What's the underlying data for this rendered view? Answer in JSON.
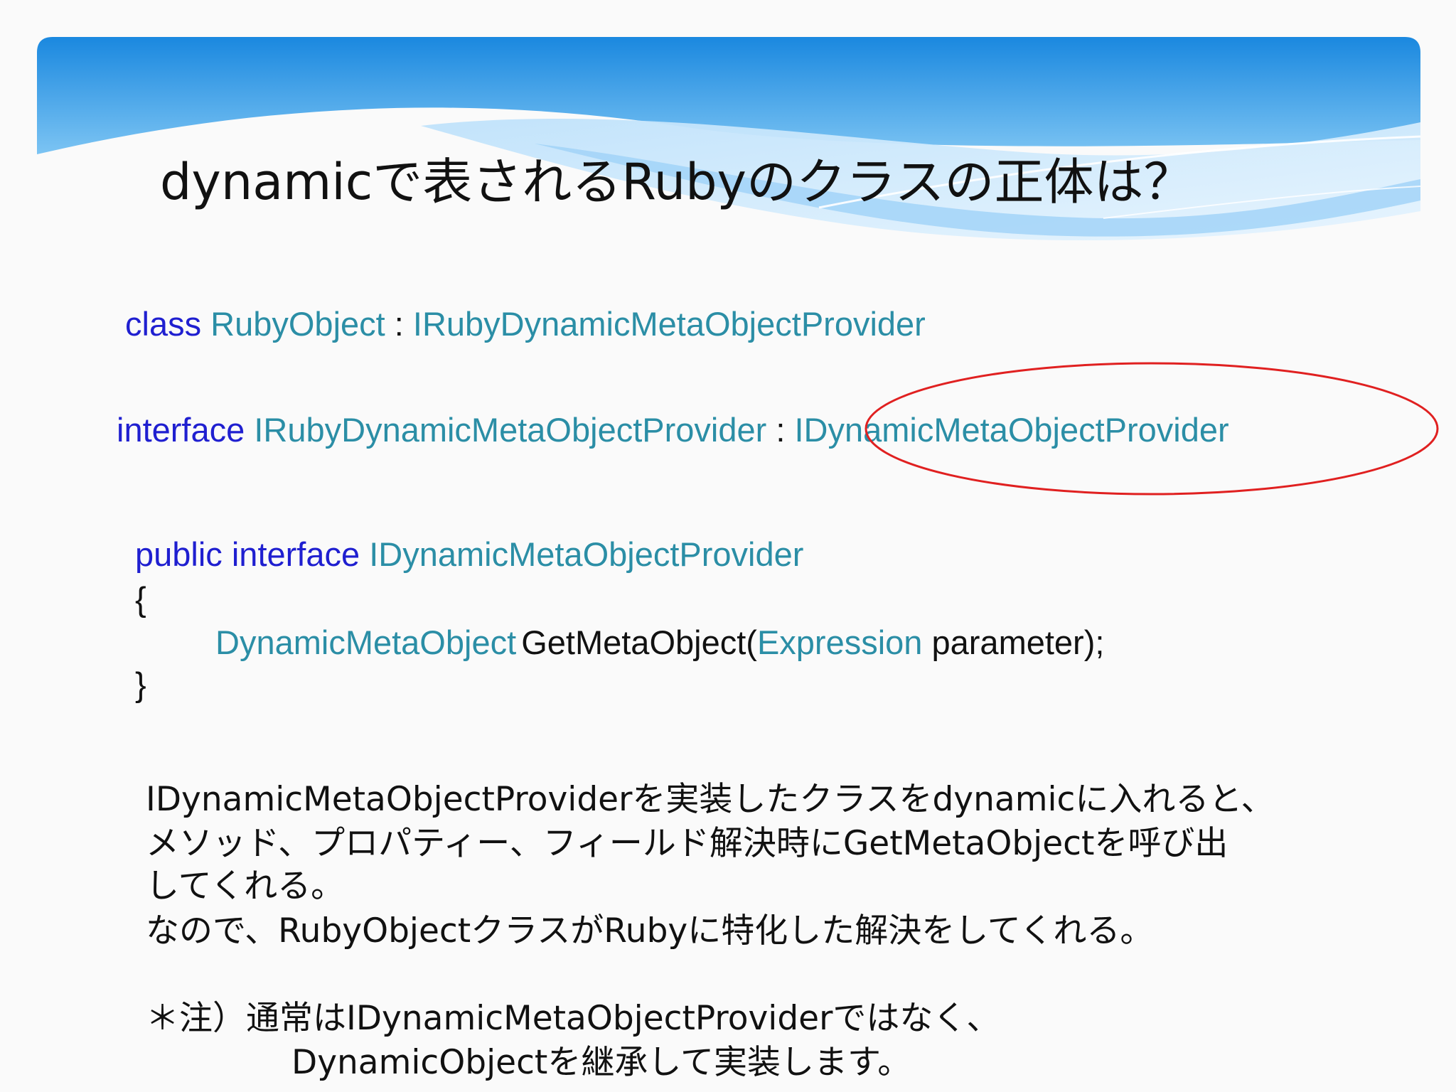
{
  "slide": {
    "title": "dynamicで表されるRubyのクラスの正体は？"
  },
  "code": {
    "line1": {
      "kw": "class",
      "type1": "RubyObject",
      "sep": ":",
      "type2": "IRubyDynamicMetaObjectProvider"
    },
    "line2": {
      "kw": "interface",
      "type1": "IRubyDynamicMetaObjectProvider",
      "sep": ":",
      "type2": "IDynamicMetaObjectProvider"
    },
    "line3": {
      "kw": "public interface",
      "type1": "IDynamicMetaObjectProvider"
    },
    "open_brace": "{",
    "method": {
      "ret_type": "DynamicMetaObject",
      "name": "GetMetaObject(",
      "param_type": "Expression",
      "rest": "parameter);"
    },
    "close_brace": "}"
  },
  "description": {
    "lines": [
      "IDynamicMetaObjectProviderを実装したクラスをdynamicに入れると、",
      "メソッド、プロパティー、フィールド解決時にGetMetaObjectを呼び出",
      "してくれる。",
      "なので、RubyObjectクラスがRubyに特化した解決をしてくれる。"
    ],
    "note_line1": "＊注）通常はIDynamicMetaObjectProviderではなく、",
    "note_line2": "DynamicObjectを継承して実装します。"
  },
  "colors": {
    "keyword": "#1f1fd0",
    "type": "#2b8ea6",
    "text": "#111111",
    "annotation": "#e02020",
    "header_blue": "#1e8fe0"
  }
}
